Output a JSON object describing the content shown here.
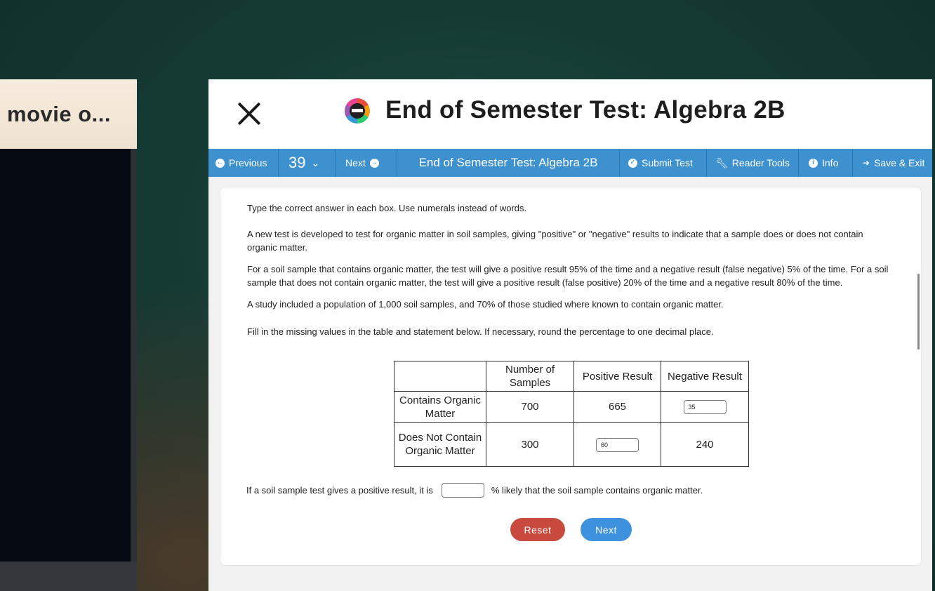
{
  "background_window": {
    "tab_title": "movie o..."
  },
  "test_window": {
    "title": "End of Semester Test: Algebra 2B",
    "toolbar": {
      "previous_label": "Previous",
      "question_number": "39",
      "next_label": "Next",
      "title": "End of Semester Test: Algebra 2B",
      "submit_label": "Submit Test",
      "reader_tools_label": "Reader Tools",
      "info_label": "Info",
      "save_exit_label": "Save & Exit"
    },
    "question": {
      "instruction": "Type the correct answer in each box. Use numerals instead of words.",
      "paragraph1": "A new test is developed to test for organic matter in soil samples, giving \"positive\" or \"negative\" results to indicate that a sample does or does not contain organic matter.",
      "paragraph2": "For a soil sample that contains organic matter, the test will give a positive result 95% of the time and a negative result (false negative) 5% of the time. For a soil sample that does not contain organic matter, the test will give a positive result (false positive) 20% of the time and a negative result 80% of the time.",
      "paragraph3": "A study included a population of 1,000 soil samples, and 70% of those studied where known to contain organic matter.",
      "fill_prompt": "Fill in the missing values in the table and statement below. If necessary, round the percentage to one decimal place.",
      "table": {
        "headers": [
          "",
          "Number of Samples",
          "Positive Result",
          "Negative Result"
        ],
        "row1": {
          "label": "Contains Organic Matter",
          "number": "700",
          "positive": "665",
          "negative_input": "35"
        },
        "row2": {
          "label": "Does Not Contain Organic Matter",
          "number": "300",
          "positive_input": "60",
          "negative": "240"
        }
      },
      "statement_before": "If a soil sample test gives a positive result, it is",
      "statement_input": "",
      "statement_after": "% likely that the soil sample contains organic matter."
    },
    "buttons": {
      "reset_label": "Reset",
      "next_label": "Next"
    }
  }
}
